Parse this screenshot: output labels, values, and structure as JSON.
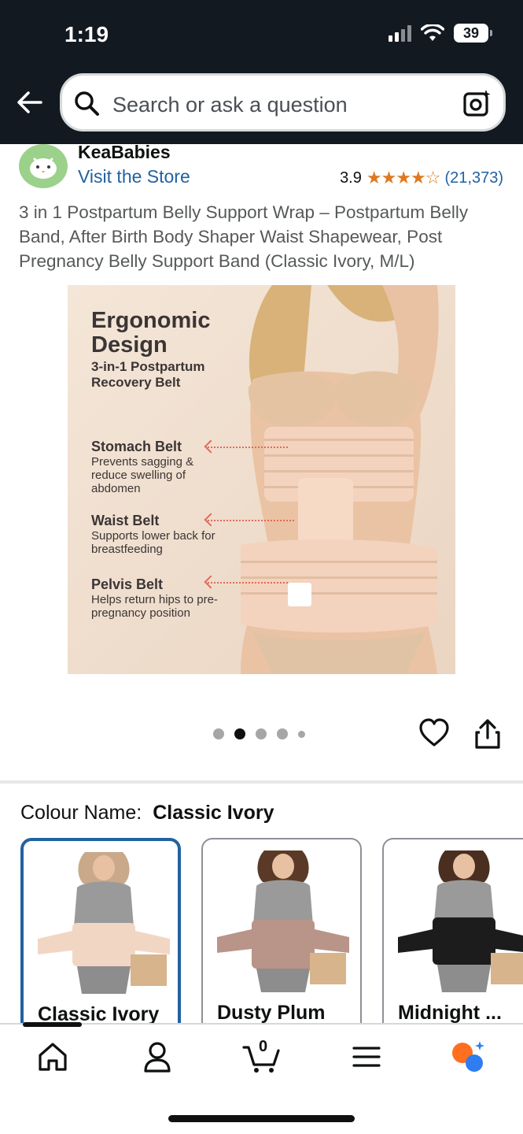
{
  "status_bar": {
    "time": "1:19",
    "battery": "39"
  },
  "search": {
    "placeholder": "Search or ask a question"
  },
  "brand": {
    "name": "KeaBabies",
    "visit_store": "Visit the Store"
  },
  "rating": {
    "value": "3.9",
    "stars": "★★★★☆",
    "count": "(21,373)",
    "star_color": "#de7921"
  },
  "product": {
    "title": "3 in 1 Postpartum Belly Support Wrap – Postpartum Belly Band, After Birth Body Shaper Waist Shapewear, Post Pregnancy Belly Support Band (Classic Ivory, M/L)"
  },
  "hero": {
    "heading_line1": "Ergonomic",
    "heading_line2": "Design",
    "sub_line1": "3-in-1 Postpartum",
    "sub_line2": "Recovery Belt",
    "belts": [
      {
        "title": "Stomach Belt",
        "desc": "Prevents sagging & reduce swelling of abdomen"
      },
      {
        "title": "Waist Belt",
        "desc": "Supports lower back for breastfeeding"
      },
      {
        "title": "Pelvis Belt",
        "desc": "Helps return hips to pre-pregnancy position"
      }
    ]
  },
  "carousel": {
    "total": 5,
    "active_index": 1
  },
  "colour": {
    "label": "Colour Name:",
    "selected": "Classic Ivory",
    "options": [
      {
        "label": "Classic Ivory",
        "color": "#f2d6c4"
      },
      {
        "label": "Dusty Plum",
        "color": "#b99488"
      },
      {
        "label": "Midnight ...",
        "color": "#1c1c1c"
      }
    ]
  },
  "colors": {
    "header_bg": "#131921",
    "link": "#2162a1",
    "selected_border": "#2162a1",
    "rufus_orange": "#ff6f1f",
    "rufus_blue": "#2f7df0"
  },
  "nav": {
    "items": [
      "home-icon",
      "account-icon",
      "cart-icon",
      "menu-icon",
      "rufus-icon"
    ],
    "cart_count": "0"
  }
}
